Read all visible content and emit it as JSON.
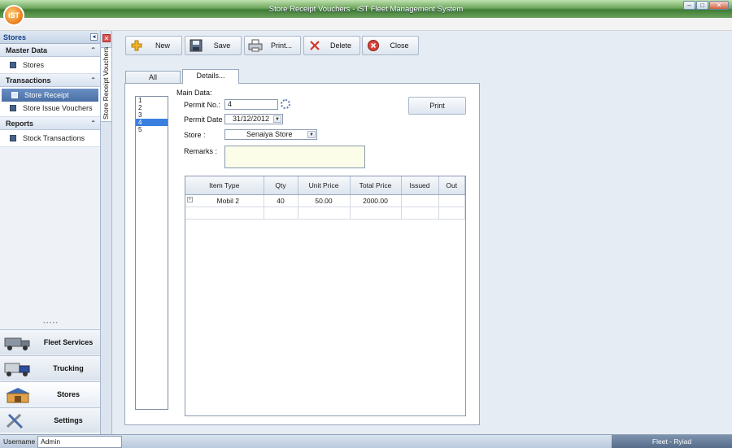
{
  "window": {
    "title": "Store Receipt Vouchers - iST Fleet Management System",
    "logo_text": "iST",
    "controls": [
      "minimize",
      "maximize",
      "close"
    ]
  },
  "nav": {
    "header": "Stores",
    "groups": [
      {
        "title": "Master Data",
        "items": [
          {
            "label": "Stores"
          }
        ]
      },
      {
        "title": "Transactions",
        "items": [
          {
            "label": "Store Receipt Vouchers",
            "selected": true
          },
          {
            "label": "Store Issue Vouchers"
          }
        ]
      },
      {
        "title": "Reports",
        "items": [
          {
            "label": "Stock Transactions"
          }
        ]
      }
    ],
    "big_buttons": [
      {
        "label": "Fleet Services",
        "icon": "truck-icon"
      },
      {
        "label": "Trucking",
        "icon": "trucks-icon"
      },
      {
        "label": "Stores",
        "icon": "warehouse-icon",
        "active": true
      },
      {
        "label": "Settings",
        "icon": "tools-icon"
      }
    ]
  },
  "side_tab": {
    "label": "Store Receipt Vouchers"
  },
  "toolbar": {
    "new_label": "New",
    "save_label": "Save",
    "print_label": "Print...",
    "delete_label": "Delete",
    "close_label": "Close"
  },
  "tabs": {
    "all_label": "All",
    "details_label": "Details..."
  },
  "record_list": {
    "items": [
      "1",
      "2",
      "3",
      "4",
      "5"
    ],
    "selected_index": 3
  },
  "details": {
    "section_label": "Main Data:",
    "permit_no_label": "Permit No.:",
    "permit_no_value": "4",
    "permit_date_label": "Permit Date :",
    "permit_date_value": "31/12/2012",
    "store_label": "Store :",
    "store_value": "Senaiya Store",
    "remarks_label": "Remarks :",
    "remarks_value": "",
    "print_label": "Print"
  },
  "grid": {
    "columns": [
      "Item Type",
      "Qty",
      "Unit Price",
      "Total Price",
      "Issued",
      "Out"
    ],
    "rows": [
      {
        "item_type": "Mobil 2",
        "qty": "40",
        "unit_price": "50.00",
        "total_price": "2000.00",
        "issued": "",
        "out": ""
      }
    ]
  },
  "status": {
    "username_label": "Username :",
    "username_value": "Admin",
    "right_text": "Fleet - Ryiad"
  },
  "colors": {
    "title_bar": "#4f8a43",
    "selection": "#4a6fa5",
    "list_selection": "#3a7fe0",
    "remarks_bg": "#fbfde8"
  }
}
